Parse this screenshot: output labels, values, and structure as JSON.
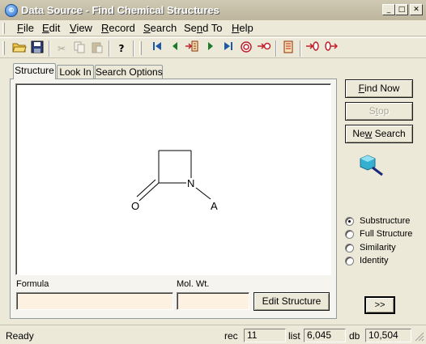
{
  "window": {
    "title": "Data Source - Find Chemical Structures",
    "minimize_glyph": "_",
    "maximize_glyph": "□",
    "close_glyph": "✕"
  },
  "menu": [
    {
      "prefix": "",
      "key": "F",
      "rest": "ile"
    },
    {
      "prefix": "",
      "key": "E",
      "rest": "dit"
    },
    {
      "prefix": "",
      "key": "V",
      "rest": "iew"
    },
    {
      "prefix": "",
      "key": "R",
      "rest": "ecord"
    },
    {
      "prefix": "",
      "key": "S",
      "rest": "earch"
    },
    {
      "prefix": "Se",
      "key": "n",
      "rest": "d To"
    },
    {
      "prefix": "",
      "key": "H",
      "rest": "elp"
    }
  ],
  "toolbar": {
    "icons": [
      "open-folder-icon",
      "save-disk-icon",
      "cut-icon",
      "copy-icon",
      "paste-icon",
      "help-question-icon",
      "first-record-icon",
      "previous-record-icon",
      "goto-record-icon",
      "next-record-icon",
      "last-record-icon",
      "target-icon",
      "browse-icon",
      "list-icon",
      "import-icon",
      "export-icon"
    ]
  },
  "tabs": [
    "Structure",
    "Look In",
    "Search Options"
  ],
  "structure": {
    "atoms": [
      "O",
      "N",
      "A"
    ]
  },
  "form": {
    "formula_label": "Formula",
    "molwt_label": "Mol. Wt.",
    "formula_value": "",
    "molwt_value": "",
    "edit_button": "Edit Structure"
  },
  "buttons": {
    "find_now": {
      "key": "F",
      "rest": "ind Now"
    },
    "stop": {
      "prefix": "S",
      "key": "t",
      "rest": "op"
    },
    "new_search": {
      "prefix": "Ne",
      "key": "w",
      "rest": " Search"
    },
    "more": ">>"
  },
  "search_types": [
    {
      "label": "Substructure",
      "checked": true
    },
    {
      "label": "Full Structure",
      "checked": false
    },
    {
      "label": "Similarity",
      "checked": false
    },
    {
      "label": "Identity",
      "checked": false
    }
  ],
  "status": {
    "message": "Ready",
    "rec_label": "rec",
    "rec_value": "11",
    "list_label": "list",
    "list_value": "6,045",
    "db_label": "db",
    "db_value": "10,504"
  },
  "colors": {
    "title_text": "#ffffff",
    "field_bg": "#fdf1e1",
    "nav_blue": "#1c5aa8",
    "nav_green": "#1a7a2a",
    "accent_red": "#c0202a",
    "query_icon": "#36b0d0"
  }
}
